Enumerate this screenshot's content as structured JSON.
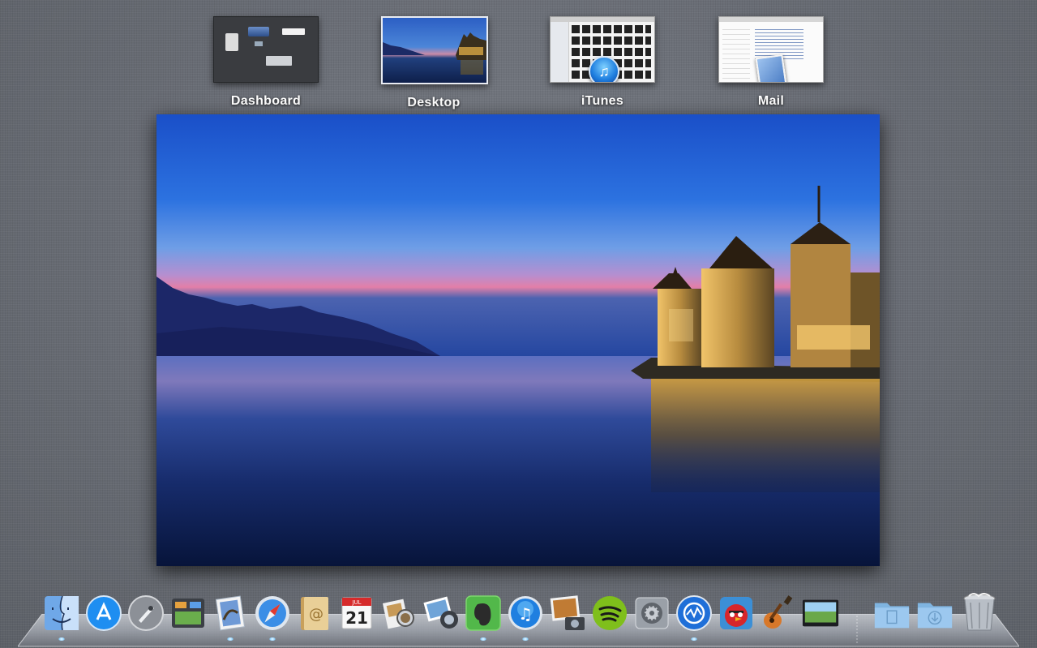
{
  "spaces": [
    {
      "id": "dashboard",
      "label": "Dashboard"
    },
    {
      "id": "desktop",
      "label": "Desktop",
      "active": true
    },
    {
      "id": "itunes",
      "label": "iTunes"
    },
    {
      "id": "mail",
      "label": "Mail"
    }
  ],
  "dock": {
    "apps": [
      {
        "name": "finder-icon",
        "running": true
      },
      {
        "name": "app-store-icon",
        "running": false
      },
      {
        "name": "launchpad-icon",
        "running": false
      },
      {
        "name": "mission-control-icon",
        "running": false
      },
      {
        "name": "mail-icon",
        "running": true
      },
      {
        "name": "safari-icon",
        "running": true
      },
      {
        "name": "address-book-icon",
        "running": false
      },
      {
        "name": "calendar-icon",
        "running": false,
        "day": "21",
        "month": "JUL"
      },
      {
        "name": "preview-icon",
        "running": false
      },
      {
        "name": "iphoto-icon",
        "running": false
      },
      {
        "name": "evernote-icon",
        "running": true
      },
      {
        "name": "itunes-icon",
        "running": true
      },
      {
        "name": "image-capture-icon",
        "running": false
      },
      {
        "name": "spotify-icon",
        "running": false
      },
      {
        "name": "system-preferences-icon",
        "running": false
      },
      {
        "name": "istat-icon",
        "running": true
      },
      {
        "name": "angry-birds-icon",
        "running": false
      },
      {
        "name": "garageband-icon",
        "running": false
      },
      {
        "name": "photo-booth-icon",
        "running": false
      }
    ],
    "folders": [
      {
        "name": "documents-folder-icon"
      },
      {
        "name": "downloads-folder-icon"
      },
      {
        "name": "trash-icon"
      }
    ]
  }
}
